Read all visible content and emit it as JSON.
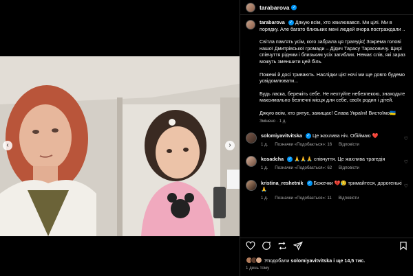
{
  "post": {
    "username": "tarabarova",
    "caption": {
      "username": "tarabarova",
      "paragraphs": [
        "Дякую всім, хто хвилювався. Ми цілі. Ми в порядку. Але багато близьких мені людей вчора постраждали ..",
        "Світла пам'ять усім, кого забрала ця трагедія🕯 Зокрема голові нашої Дмитрівської громади – Дідич Тарасу Тарасовичу. Щирі співчуття рідним і близьким усіх загиблих. Немає слів, які зараз можуть зменшити цей біль.",
        "Пожежі й досі тривають. Наслідки цієї ночі ми ще довго будемо усвідомлювати...",
        "Будь ласка, бережіть себе. Не нехтуйте небезпекою, знаходьте максимально безпечні місця для себе, своїх родин і дітей.",
        "Дякую всім, хто рятує, захищає! Слава Україні! Вистоїмо🇺🇦"
      ],
      "edited": "Змінено · 1 д."
    },
    "comments": [
      {
        "username": "solomiyavitvitska",
        "text": "Це жахлива ніч. Обіймаю ❤️",
        "time": "1 д.",
        "likes": "Позначки «Подобається»: 16",
        "reply": "Відповісти"
      },
      {
        "username": "kosadcha",
        "text": "🙏🙏🙏 співчуття. Це жахлива трагедія",
        "time": "1 д.",
        "likes": "Позначки «Подобається»: 62",
        "reply": "Відповісти"
      },
      {
        "username": "kristina_reshetnik",
        "text": "Божечки 💔😥 тримайтеся, дорогенькі 🙏",
        "time": "1 д.",
        "likes": "Позначки «Подобається»: 11",
        "reply": "Відповісти"
      }
    ],
    "likes_text_prefix": "Уподобали",
    "likes_text_user": "solomiyavitvitska",
    "likes_text_suffix": "і ще 14,5 тис.",
    "posted_time": "1 день тому"
  },
  "colors": {
    "accent": "#0095f6",
    "like": "#ed4956"
  },
  "icons": [
    "heart-icon",
    "comment-icon",
    "share-icon",
    "save-icon",
    "verified-icon",
    "chevron-left-icon",
    "chevron-right-icon"
  ]
}
